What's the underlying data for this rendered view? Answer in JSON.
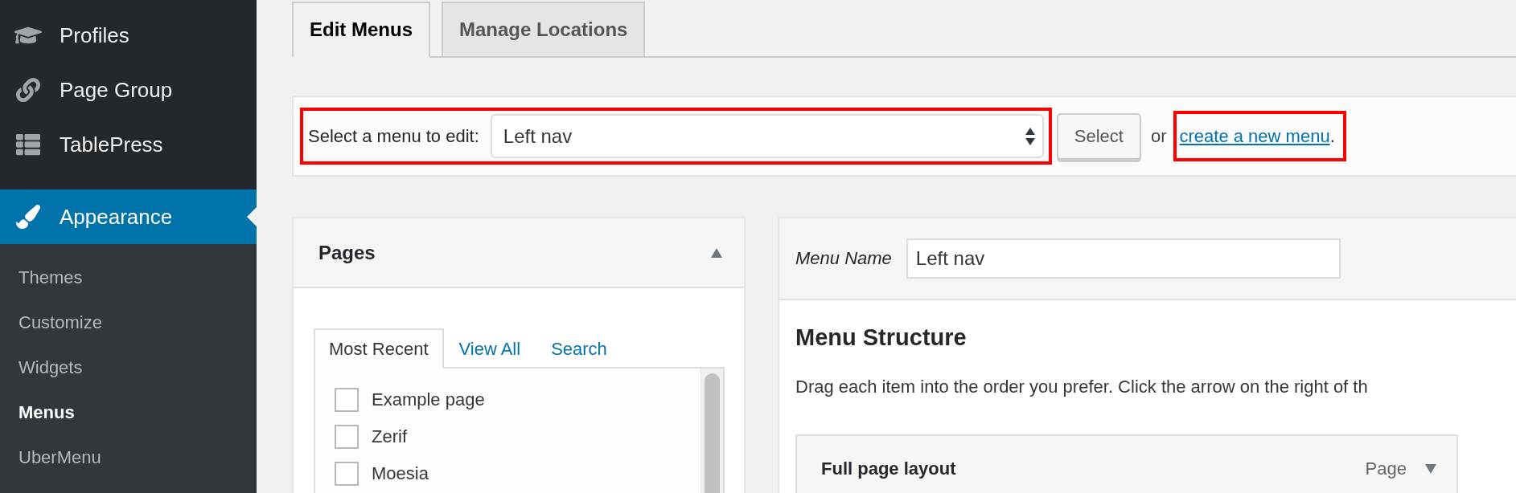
{
  "sidebar": {
    "items": [
      {
        "label": "Profiles",
        "selected": false
      },
      {
        "label": "Page Group",
        "selected": false
      },
      {
        "label": "TablePress",
        "selected": false
      },
      {
        "label": "Appearance",
        "selected": true
      }
    ],
    "submenu": [
      {
        "label": "Themes",
        "selected": false
      },
      {
        "label": "Customize",
        "selected": false
      },
      {
        "label": "Widgets",
        "selected": false
      },
      {
        "label": "Menus",
        "selected": true
      },
      {
        "label": "UberMenu",
        "selected": false
      }
    ]
  },
  "tabs": [
    {
      "label": "Edit Menus",
      "selected": true
    },
    {
      "label": "Manage Locations",
      "selected": false
    }
  ],
  "menu_select": {
    "label": "Select a menu to edit:",
    "value": "Left nav",
    "button": "Select",
    "or_text": "or",
    "link": "create a new menu",
    "after_link": "."
  },
  "pages_panel": {
    "title": "Pages",
    "expanded": true,
    "tabs": [
      {
        "label": "Most Recent",
        "selected": true
      },
      {
        "label": "View All",
        "selected": false
      },
      {
        "label": "Search",
        "selected": false
      }
    ],
    "items": [
      {
        "label": "Example page",
        "checked": false
      },
      {
        "label": "Zerif",
        "checked": false
      },
      {
        "label": "Moesia",
        "checked": false
      }
    ]
  },
  "menu_editor": {
    "name_label": "Menu Name",
    "name_value": "Left nav",
    "heading": "Menu Structure",
    "description": "Drag each item into the order you prefer. Click the arrow on the right of th",
    "items": [
      {
        "title": "Full page layout",
        "type": "Page",
        "expanded": false
      }
    ]
  }
}
